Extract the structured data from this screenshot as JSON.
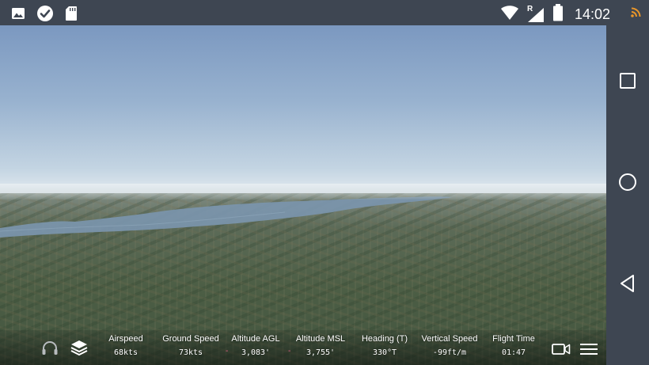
{
  "status_bar": {
    "time": "14:02",
    "left_icons": [
      "image-icon",
      "check-circle-icon",
      "sd-card-icon"
    ],
    "right_icons": [
      "wifi-icon",
      "signal-roaming-icon",
      "battery-icon"
    ],
    "signal_label": "R"
  },
  "hud": {
    "stats": [
      {
        "label": "Airspeed",
        "value": "68kts"
      },
      {
        "label": "Ground Speed",
        "value": "73kts"
      },
      {
        "label": "Altitude AGL",
        "value": "3,083'"
      },
      {
        "label": "Altitude MSL",
        "value": "3,755'"
      },
      {
        "label": "Heading (T)",
        "value": "330°T"
      },
      {
        "label": "Vertical Speed",
        "value": "-99ft/m"
      },
      {
        "label": "Flight Time",
        "value": "01:47"
      }
    ],
    "separator": "-",
    "left_icons": [
      "headset-icon",
      "layers-icon"
    ],
    "right_icons": [
      "video-camera-icon",
      "menu-icon"
    ]
  },
  "nav_bar": {
    "buttons": [
      "recents-button",
      "home-button",
      "back-button"
    ]
  },
  "colors": {
    "status_bar": "#3e4652",
    "nav_bar": "#3e4652",
    "separator": "#e0608a",
    "rss": "#e8962a"
  }
}
